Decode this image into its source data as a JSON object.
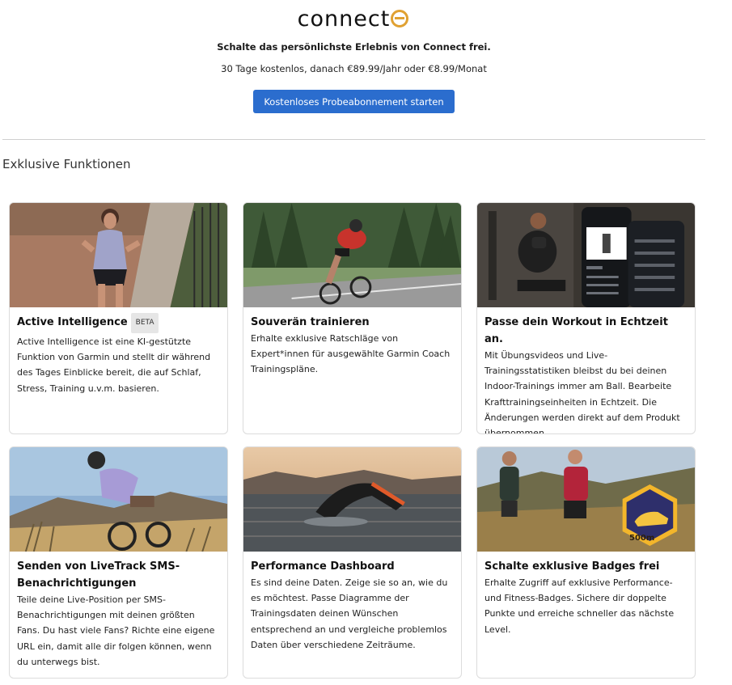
{
  "logo": {
    "text_part": "connect",
    "accent": "#e0a132"
  },
  "hero": {
    "headline": "Schalte das persönlichste Erlebnis von Connect frei.",
    "price_line": "30 Tage kostenlos, danach €89.99/Jahr oder €8.99/Monat",
    "cta_label": "Kostenloses Probeabonnement starten",
    "cta_color": "#2b6dce"
  },
  "features": {
    "section_title": "Exklusive Funktionen",
    "cards": [
      {
        "title": "Active Intelligence",
        "badge": "BETA",
        "text": "Active Intelligence ist eine KI-gestützte Funktion von Garmin und stellt dir während des Tages Einblicke bereit, die auf Schlaf, Stress, Training u.v.m. basieren."
      },
      {
        "title": "Souverän trainieren",
        "text": "Erhalte exklusive Ratschläge von Expert*innen für ausgewählte Garmin Coach Trainingspläne."
      },
      {
        "title": "Passe dein Workout in Echtzeit an.",
        "text": "Mit Übungsvideos und Live-Trainingsstatistiken bleibst du bei deinen Indoor-Trainings immer am Ball. Bearbeite Krafttrainingseinheiten in Echtzeit. Die Änderungen werden direkt auf dem Produkt übernommen."
      },
      {
        "title": "Senden von LiveTrack SMS-Benachrichtigungen",
        "text": "Teile deine Live-Position per SMS-Benachrichtigungen mit deinen größten Fans. Du hast viele Fans? Richte eine eigene URL ein, damit alle dir folgen können, wenn du unterwegs bist."
      },
      {
        "title": "Performance Dashboard",
        "text": "Es sind deine Daten. Zeige sie so an, wie du es möchtest. Passe Diagramme der Trainingsdaten deinen Wünschen entsprechend an und vergleiche problemlos Daten über verschiedene Zeiträume."
      },
      {
        "title": "Schalte exklusive Badges frei",
        "text": "Erhalte Zugriff auf exklusive Performance- und Fitness-Badges. Sichere dir doppelte Punkte und erreiche schneller das nächste Level.",
        "image_badge_text": "500m"
      }
    ]
  }
}
